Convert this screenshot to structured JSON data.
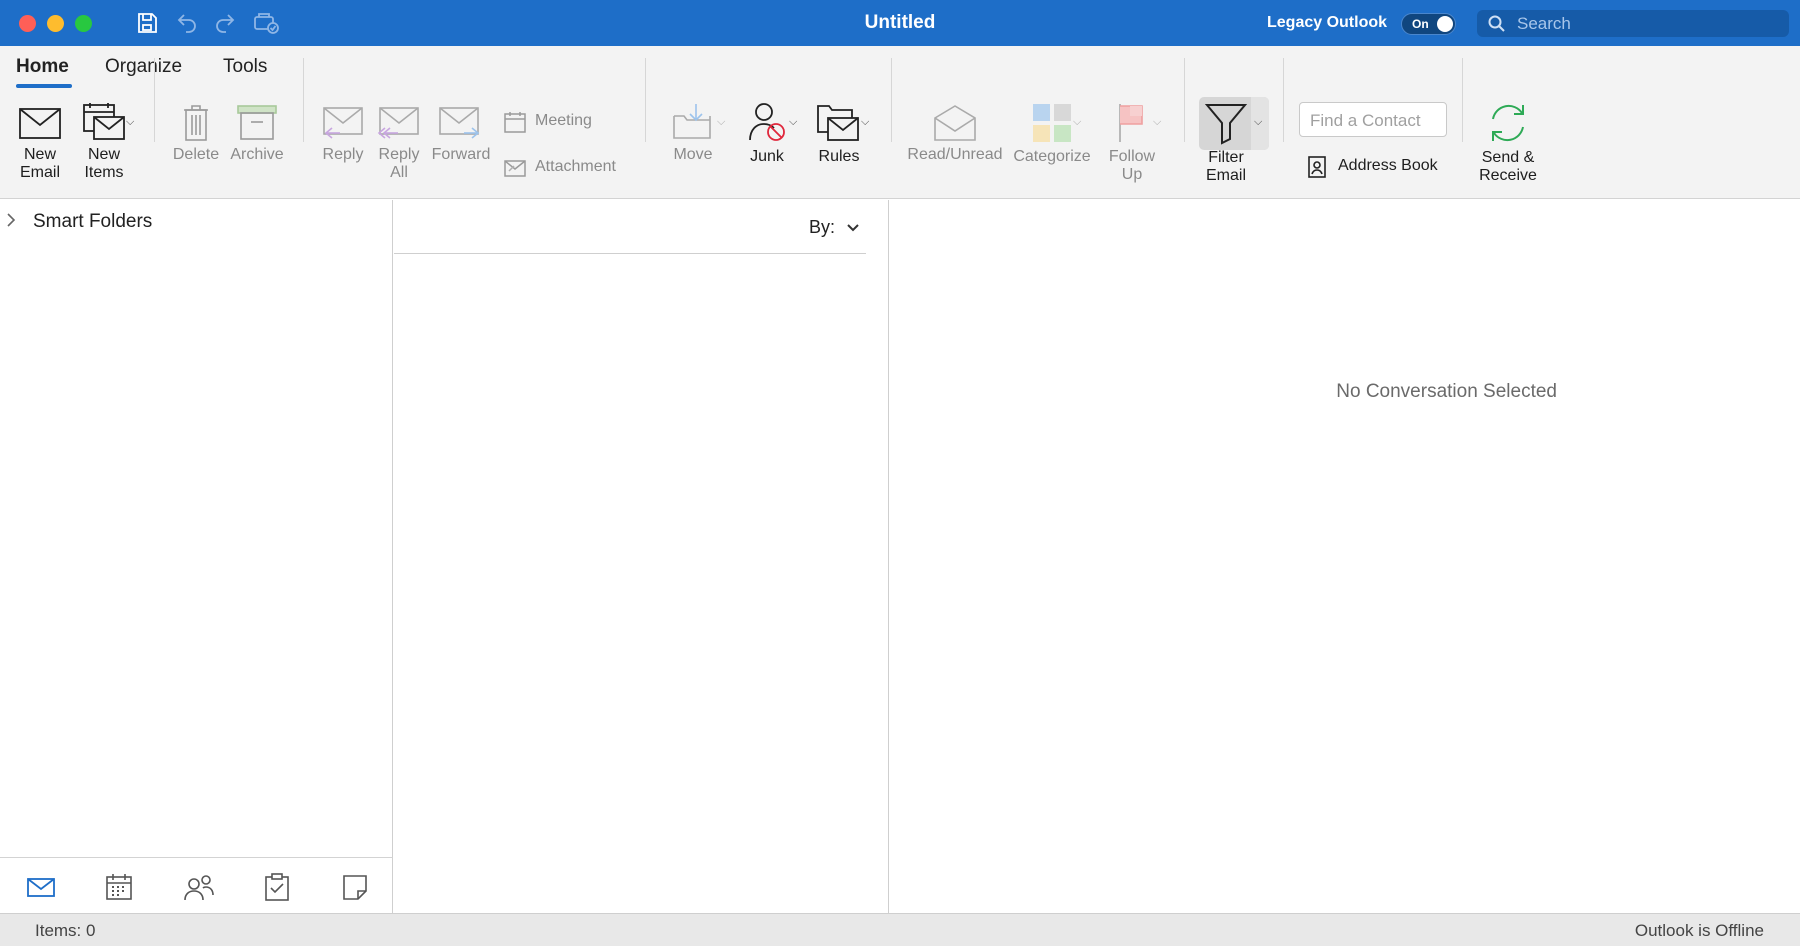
{
  "window": {
    "title": "Untitled",
    "legacy_label": "Legacy Outlook",
    "legacy_toggle": "On",
    "search_placeholder": "Search"
  },
  "titlebar_icons": [
    "save-icon",
    "undo-icon",
    "redo-icon",
    "print-icon"
  ],
  "ribbon": {
    "tabs": [
      {
        "label": "Home",
        "active": true
      },
      {
        "label": "Organize",
        "active": false
      },
      {
        "label": "Tools",
        "active": false
      }
    ],
    "new_email": [
      "New",
      "Email"
    ],
    "new_items": [
      "New",
      "Items"
    ],
    "delete": "Delete",
    "archive": "Archive",
    "reply": "Reply",
    "reply_all": [
      "Reply",
      "All"
    ],
    "forward": "Forward",
    "meeting": "Meeting",
    "attachment": "Attachment",
    "move": "Move",
    "junk": "Junk",
    "rules": "Rules",
    "read_unread": "Read/Unread",
    "categorize": "Categorize",
    "follow_up": [
      "Follow",
      "Up"
    ],
    "filter_email": [
      "Filter",
      "Email"
    ],
    "find_contact_placeholder": "Find a Contact",
    "address_book": "Address Book",
    "send_receive": [
      "Send &",
      "Receive"
    ]
  },
  "folders": {
    "smart_folders": "Smart Folders"
  },
  "message_list": {
    "sort_label": "By:"
  },
  "reading_pane": {
    "empty_text": "No Conversation Selected"
  },
  "nav": [
    "mail-icon",
    "calendar-icon",
    "people-icon",
    "tasks-icon",
    "notes-icon"
  ],
  "status": {
    "items": "Items: 0",
    "connection": "Outlook is Offline"
  },
  "colors": {
    "titlebar": "#1e6ec8",
    "accent": "#1e6ec8",
    "ribbon_bg": "#f3f3f3",
    "send_receive_green": "#2eaa56"
  }
}
